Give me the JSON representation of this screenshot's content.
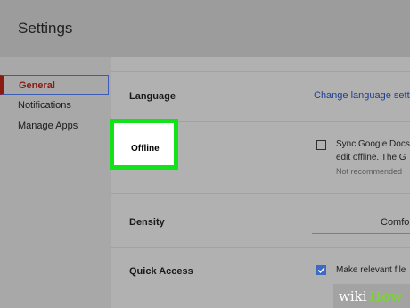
{
  "header": {
    "title": "Settings"
  },
  "sidebar": {
    "items": [
      {
        "label": "General",
        "active": true
      },
      {
        "label": "Notifications"
      },
      {
        "label": "Manage Apps"
      }
    ]
  },
  "rows": {
    "language": {
      "label": "Language",
      "link": "Change language setti"
    },
    "offline": {
      "label": "Offline",
      "checkbox_label_line1": "Sync Google Docs",
      "checkbox_label_line2": "edit offline. The G",
      "note": "Not recommended",
      "checked": false
    },
    "density": {
      "label": "Density",
      "value": "Comfo"
    },
    "quick_access": {
      "label": "Quick Access",
      "checkbox_label": "Make relevant file",
      "checked": true
    }
  },
  "colors": {
    "highlight": "#12e21a",
    "active_nav": "#8b1a10",
    "link": "#1d3f8f",
    "checkbox": "#3c6ac4"
  },
  "watermark": {
    "wiki": "wiki",
    "how": "How"
  }
}
